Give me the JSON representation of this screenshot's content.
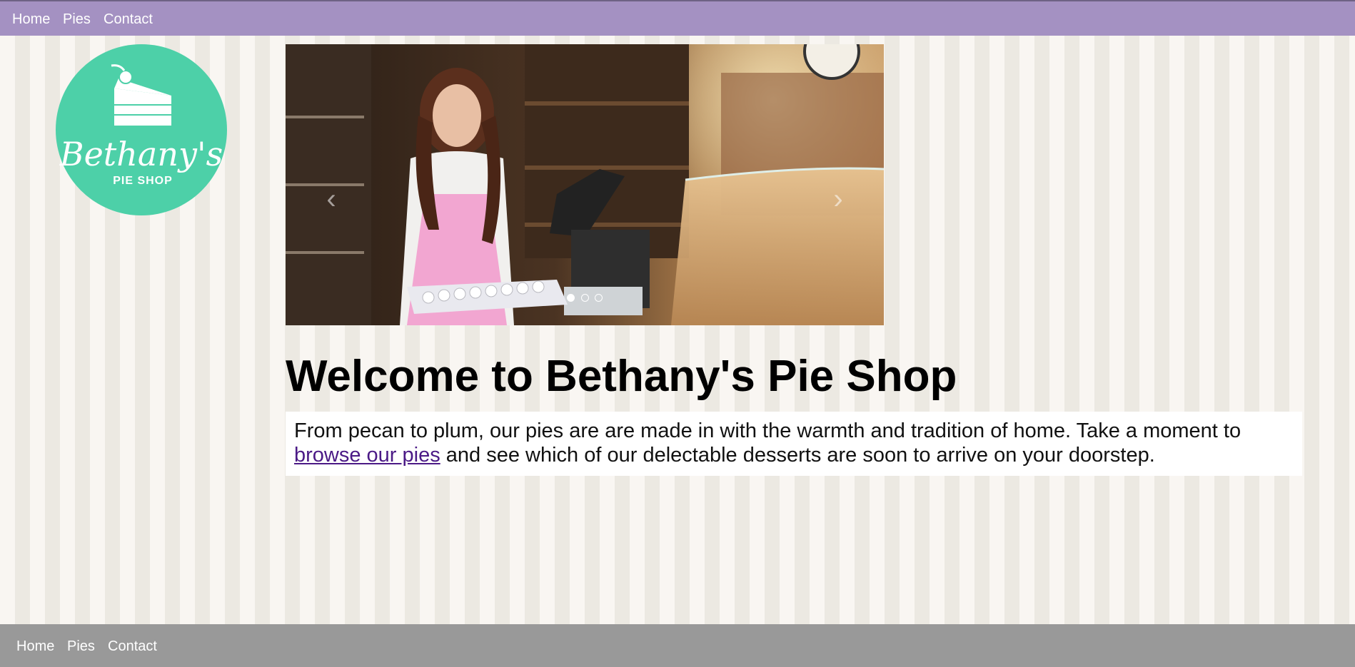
{
  "top_nav": {
    "items": [
      "Home",
      "Pies",
      "Contact"
    ]
  },
  "logo": {
    "text_main": "Bethany's",
    "text_sub": "PIE SHOP",
    "brand_color": "#4dd0a8"
  },
  "carousel": {
    "prev_arrow": "‹",
    "next_arrow": "›",
    "slide_count": 3,
    "active_slide": 1
  },
  "main": {
    "heading": "Welcome to Bethany's Pie Shop",
    "intro_before": "From pecan to plum, our pies are are made in with the warmth and tradition of home. Take a moment to ",
    "intro_link": "browse our pies",
    "intro_after": " and see which of our delectable desserts are soon to arrive on your doorstep."
  },
  "footer_nav": {
    "items": [
      "Home",
      "Pies",
      "Contact"
    ]
  },
  "colors": {
    "nav_bg": "#a491c2",
    "footer_bg": "#999999",
    "link": "#4b1a86"
  }
}
